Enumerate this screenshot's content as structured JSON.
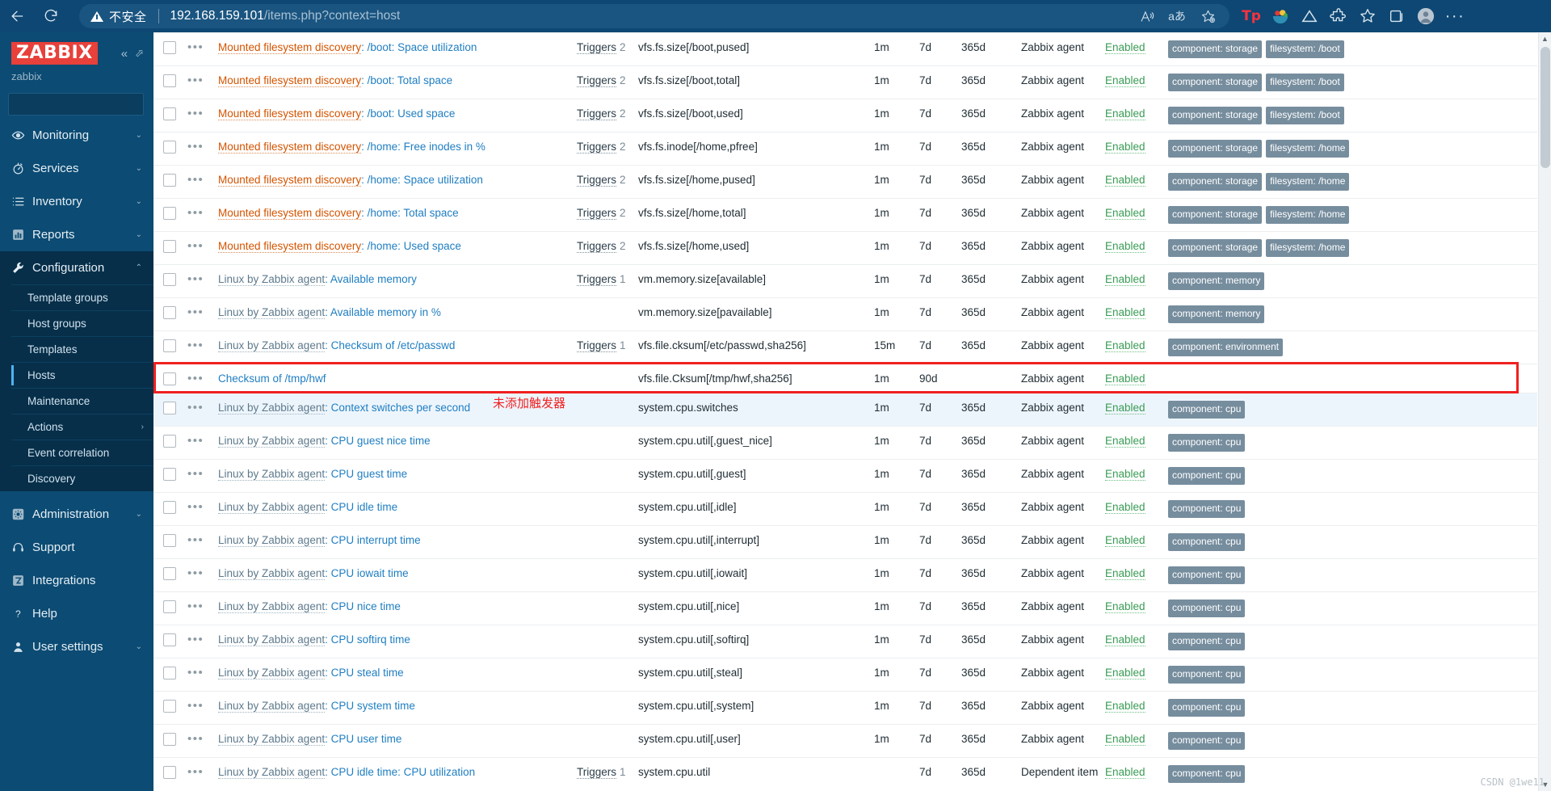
{
  "browser": {
    "back_label": "back-arrow",
    "reload_label": "reload",
    "security_text": "不安全",
    "url_host": "192.168.159.101",
    "url_path": "/items.php?context=host",
    "read_aloud_label": "A",
    "translate_label": "aあ",
    "favorite_label": "add-favorite",
    "ext_tp_label": "Tp",
    "more_label": "···"
  },
  "sidebar": {
    "logo": "ZABBIX",
    "user": "zabbix",
    "search_placeholder": "",
    "search_value": "",
    "items": [
      {
        "label": "Monitoring",
        "icon": "eye-icon",
        "chevron": "⌄",
        "active": false
      },
      {
        "label": "Services",
        "icon": "stopwatch-icon",
        "chevron": "⌄",
        "active": false
      },
      {
        "label": "Inventory",
        "icon": "list-icon",
        "chevron": "⌄",
        "active": false
      },
      {
        "label": "Reports",
        "icon": "bar-chart-icon",
        "chevron": "⌄",
        "active": false
      },
      {
        "label": "Configuration",
        "icon": "wrench-icon",
        "chevron": "⌃",
        "active": true
      }
    ],
    "submenu": [
      {
        "label": "Template groups",
        "selected": false,
        "chevron": ""
      },
      {
        "label": "Host groups",
        "selected": false,
        "chevron": ""
      },
      {
        "label": "Templates",
        "selected": false,
        "chevron": ""
      },
      {
        "label": "Hosts",
        "selected": true,
        "chevron": ""
      },
      {
        "label": "Maintenance",
        "selected": false,
        "chevron": ""
      },
      {
        "label": "Actions",
        "selected": false,
        "chevron": "›"
      },
      {
        "label": "Event correlation",
        "selected": false,
        "chevron": ""
      },
      {
        "label": "Discovery",
        "selected": false,
        "chevron": ""
      }
    ],
    "bottom_items": [
      {
        "label": "Administration",
        "icon": "gear-icon",
        "chevron": "⌄"
      },
      {
        "label": "Support",
        "icon": "headset-icon",
        "chevron": ""
      },
      {
        "label": "Integrations",
        "icon": "zabbix-z-icon",
        "chevron": ""
      },
      {
        "label": "Help",
        "icon": "question-icon",
        "chevron": ""
      },
      {
        "label": "User settings",
        "icon": "user-icon",
        "chevron": "⌄"
      }
    ]
  },
  "annotation": {
    "text": "未添加触发器",
    "color": "#f02020"
  },
  "watermark": "CSDN @1we11",
  "table": {
    "rows": [
      {
        "template": "Mounted filesystem discovery",
        "template_style": "orange",
        "name": ": /boot: Space utilization",
        "triggers": "Triggers",
        "trigger_count": "2",
        "key": "vfs.fs.size[/boot,pused]",
        "interval": "1m",
        "history": "7d",
        "trends": "365d",
        "type": "Zabbix agent",
        "status": "Enabled",
        "tags": [
          "component: storage",
          "filesystem: /boot"
        ],
        "alt": false,
        "highlight": false
      },
      {
        "template": "Mounted filesystem discovery",
        "template_style": "orange",
        "name": ": /boot: Total space",
        "triggers": "Triggers",
        "trigger_count": "2",
        "key": "vfs.fs.size[/boot,total]",
        "interval": "1m",
        "history": "7d",
        "trends": "365d",
        "type": "Zabbix agent",
        "status": "Enabled",
        "tags": [
          "component: storage",
          "filesystem: /boot"
        ],
        "alt": false,
        "highlight": false
      },
      {
        "template": "Mounted filesystem discovery",
        "template_style": "orange",
        "name": ": /boot: Used space",
        "triggers": "Triggers",
        "trigger_count": "2",
        "key": "vfs.fs.size[/boot,used]",
        "interval": "1m",
        "history": "7d",
        "trends": "365d",
        "type": "Zabbix agent",
        "status": "Enabled",
        "tags": [
          "component: storage",
          "filesystem: /boot"
        ],
        "alt": false,
        "highlight": false
      },
      {
        "template": "Mounted filesystem discovery",
        "template_style": "orange",
        "name": ": /home: Free inodes in %",
        "triggers": "Triggers",
        "trigger_count": "2",
        "key": "vfs.fs.inode[/home,pfree]",
        "interval": "1m",
        "history": "7d",
        "trends": "365d",
        "type": "Zabbix agent",
        "status": "Enabled",
        "tags": [
          "component: storage",
          "filesystem: /home"
        ],
        "alt": false,
        "highlight": false
      },
      {
        "template": "Mounted filesystem discovery",
        "template_style": "orange",
        "name": ": /home: Space utilization",
        "triggers": "Triggers",
        "trigger_count": "2",
        "key": "vfs.fs.size[/home,pused]",
        "interval": "1m",
        "history": "7d",
        "trends": "365d",
        "type": "Zabbix agent",
        "status": "Enabled",
        "tags": [
          "component: storage",
          "filesystem: /home"
        ],
        "alt": false,
        "highlight": false
      },
      {
        "template": "Mounted filesystem discovery",
        "template_style": "orange",
        "name": ": /home: Total space",
        "triggers": "Triggers",
        "trigger_count": "2",
        "key": "vfs.fs.size[/home,total]",
        "interval": "1m",
        "history": "7d",
        "trends": "365d",
        "type": "Zabbix agent",
        "status": "Enabled",
        "tags": [
          "component: storage",
          "filesystem: /home"
        ],
        "alt": false,
        "highlight": false
      },
      {
        "template": "Mounted filesystem discovery",
        "template_style": "orange",
        "name": ": /home: Used space",
        "triggers": "Triggers",
        "trigger_count": "2",
        "key": "vfs.fs.size[/home,used]",
        "interval": "1m",
        "history": "7d",
        "trends": "365d",
        "type": "Zabbix agent",
        "status": "Enabled",
        "tags": [
          "component: storage",
          "filesystem: /home"
        ],
        "alt": false,
        "highlight": false
      },
      {
        "template": "Linux by Zabbix agent",
        "template_style": "grey",
        "name": ": Available memory",
        "triggers": "Triggers",
        "trigger_count": "1",
        "key": "vm.memory.size[available]",
        "interval": "1m",
        "history": "7d",
        "trends": "365d",
        "type": "Zabbix agent",
        "status": "Enabled",
        "tags": [
          "component: memory"
        ],
        "alt": false,
        "highlight": false
      },
      {
        "template": "Linux by Zabbix agent",
        "template_style": "grey",
        "name": ": Available memory in %",
        "triggers": "",
        "trigger_count": "",
        "key": "vm.memory.size[pavailable]",
        "interval": "1m",
        "history": "7d",
        "trends": "365d",
        "type": "Zabbix agent",
        "status": "Enabled",
        "tags": [
          "component: memory"
        ],
        "alt": false,
        "highlight": false
      },
      {
        "template": "Linux by Zabbix agent",
        "template_style": "grey",
        "name": ": Checksum of /etc/passwd",
        "triggers": "Triggers",
        "trigger_count": "1",
        "key": "vfs.file.cksum[/etc/passwd,sha256]",
        "interval": "15m",
        "history": "7d",
        "trends": "365d",
        "type": "Zabbix agent",
        "status": "Enabled",
        "tags": [
          "component: environment"
        ],
        "alt": false,
        "highlight": false
      },
      {
        "template": "",
        "template_style": "none",
        "name": "Checksum of /tmp/hwf",
        "triggers": "",
        "trigger_count": "",
        "key": "vfs.file.Cksum[/tmp/hwf,sha256]",
        "interval": "1m",
        "history": "90d",
        "trends": "",
        "type": "Zabbix agent",
        "status": "Enabled",
        "tags": [],
        "alt": false,
        "highlight": true
      },
      {
        "template": "Linux by Zabbix agent",
        "template_style": "grey",
        "name": ": Context switches per second",
        "triggers": "",
        "trigger_count": "",
        "key": "system.cpu.switches",
        "interval": "1m",
        "history": "7d",
        "trends": "365d",
        "type": "Zabbix agent",
        "status": "Enabled",
        "tags": [
          "component: cpu"
        ],
        "alt": true,
        "highlight": false
      },
      {
        "template": "Linux by Zabbix agent",
        "template_style": "grey",
        "name": ": CPU guest nice time",
        "triggers": "",
        "trigger_count": "",
        "key": "system.cpu.util[,guest_nice]",
        "interval": "1m",
        "history": "7d",
        "trends": "365d",
        "type": "Zabbix agent",
        "status": "Enabled",
        "tags": [
          "component: cpu"
        ],
        "alt": false,
        "highlight": false
      },
      {
        "template": "Linux by Zabbix agent",
        "template_style": "grey",
        "name": ": CPU guest time",
        "triggers": "",
        "trigger_count": "",
        "key": "system.cpu.util[,guest]",
        "interval": "1m",
        "history": "7d",
        "trends": "365d",
        "type": "Zabbix agent",
        "status": "Enabled",
        "tags": [
          "component: cpu"
        ],
        "alt": false,
        "highlight": false
      },
      {
        "template": "Linux by Zabbix agent",
        "template_style": "grey",
        "name": ": CPU idle time",
        "triggers": "",
        "trigger_count": "",
        "key": "system.cpu.util[,idle]",
        "interval": "1m",
        "history": "7d",
        "trends": "365d",
        "type": "Zabbix agent",
        "status": "Enabled",
        "tags": [
          "component: cpu"
        ],
        "alt": false,
        "highlight": false
      },
      {
        "template": "Linux by Zabbix agent",
        "template_style": "grey",
        "name": ": CPU interrupt time",
        "triggers": "",
        "trigger_count": "",
        "key": "system.cpu.util[,interrupt]",
        "interval": "1m",
        "history": "7d",
        "trends": "365d",
        "type": "Zabbix agent",
        "status": "Enabled",
        "tags": [
          "component: cpu"
        ],
        "alt": false,
        "highlight": false
      },
      {
        "template": "Linux by Zabbix agent",
        "template_style": "grey",
        "name": ": CPU iowait time",
        "triggers": "",
        "trigger_count": "",
        "key": "system.cpu.util[,iowait]",
        "interval": "1m",
        "history": "7d",
        "trends": "365d",
        "type": "Zabbix agent",
        "status": "Enabled",
        "tags": [
          "component: cpu"
        ],
        "alt": false,
        "highlight": false
      },
      {
        "template": "Linux by Zabbix agent",
        "template_style": "grey",
        "name": ": CPU nice time",
        "triggers": "",
        "trigger_count": "",
        "key": "system.cpu.util[,nice]",
        "interval": "1m",
        "history": "7d",
        "trends": "365d",
        "type": "Zabbix agent",
        "status": "Enabled",
        "tags": [
          "component: cpu"
        ],
        "alt": false,
        "highlight": false
      },
      {
        "template": "Linux by Zabbix agent",
        "template_style": "grey",
        "name": ": CPU softirq time",
        "triggers": "",
        "trigger_count": "",
        "key": "system.cpu.util[,softirq]",
        "interval": "1m",
        "history": "7d",
        "trends": "365d",
        "type": "Zabbix agent",
        "status": "Enabled",
        "tags": [
          "component: cpu"
        ],
        "alt": false,
        "highlight": false
      },
      {
        "template": "Linux by Zabbix agent",
        "template_style": "grey",
        "name": ": CPU steal time",
        "triggers": "",
        "trigger_count": "",
        "key": "system.cpu.util[,steal]",
        "interval": "1m",
        "history": "7d",
        "trends": "365d",
        "type": "Zabbix agent",
        "status": "Enabled",
        "tags": [
          "component: cpu"
        ],
        "alt": false,
        "highlight": false
      },
      {
        "template": "Linux by Zabbix agent",
        "template_style": "grey",
        "name": ": CPU system time",
        "triggers": "",
        "trigger_count": "",
        "key": "system.cpu.util[,system]",
        "interval": "1m",
        "history": "7d",
        "trends": "365d",
        "type": "Zabbix agent",
        "status": "Enabled",
        "tags": [
          "component: cpu"
        ],
        "alt": false,
        "highlight": false
      },
      {
        "template": "Linux by Zabbix agent",
        "template_style": "grey",
        "name": ": CPU user time",
        "triggers": "",
        "trigger_count": "",
        "key": "system.cpu.util[,user]",
        "interval": "1m",
        "history": "7d",
        "trends": "365d",
        "type": "Zabbix agent",
        "status": "Enabled",
        "tags": [
          "component: cpu"
        ],
        "alt": false,
        "highlight": false
      },
      {
        "template": "Linux by Zabbix agent",
        "template_style": "grey",
        "name": ": CPU idle time: CPU utilization",
        "triggers": "Triggers",
        "trigger_count": "1",
        "key": "system.cpu.util",
        "interval": "",
        "history": "7d",
        "trends": "365d",
        "type": "Dependent item",
        "status": "Enabled",
        "tags": [
          "component: cpu"
        ],
        "alt": false,
        "highlight": false
      }
    ]
  }
}
